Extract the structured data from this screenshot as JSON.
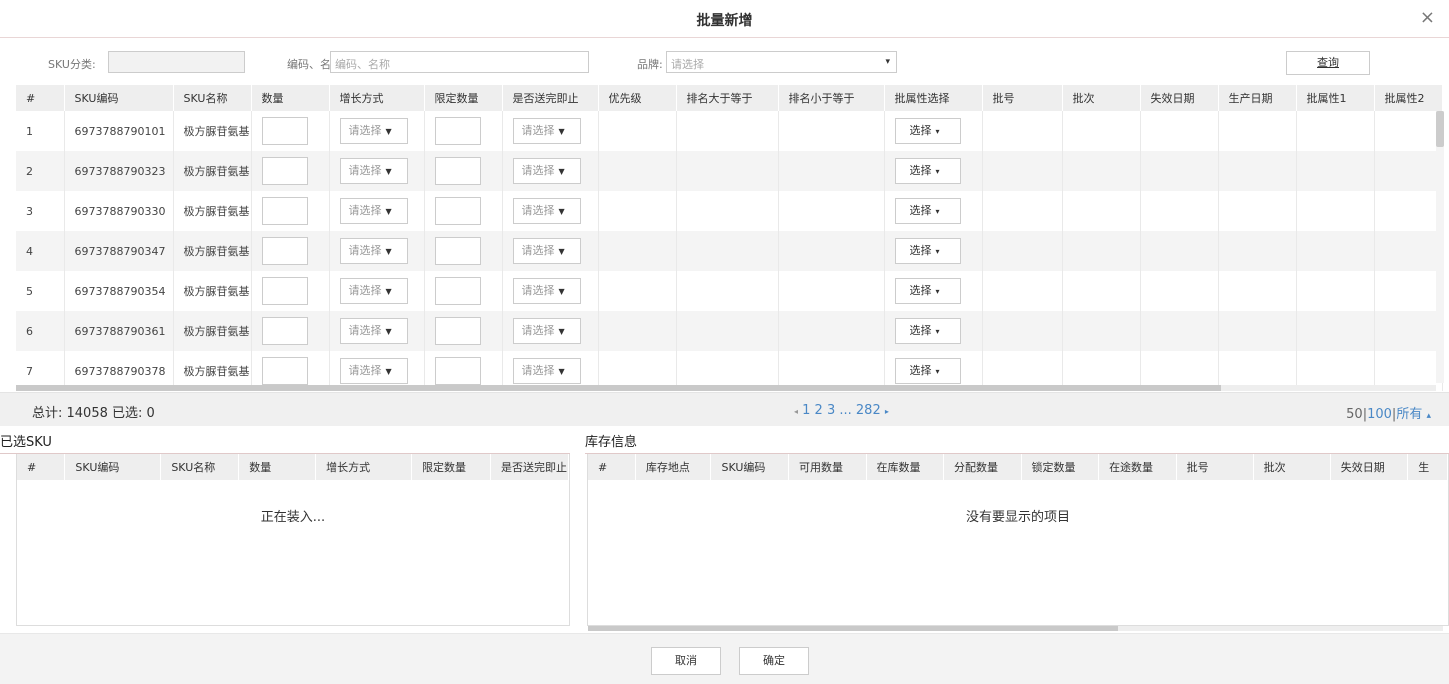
{
  "dialog": {
    "title": "批量新增",
    "close_glyph": "×"
  },
  "filters": {
    "sku_category_label": "SKU分类:",
    "code_name_label": "编码、名称:",
    "code_name_placeholder": "编码、名称",
    "brand_label": "品牌:",
    "brand_placeholder": "请选择",
    "query_label": "查询"
  },
  "main_table": {
    "headers": [
      "#",
      "SKU编码",
      "SKU名称",
      "数量",
      "增长方式",
      "限定数量",
      "是否送完即止",
      "优先级",
      "排名大于等于",
      "排名小于等于",
      "批属性选择",
      "批号",
      "批次",
      "失效日期",
      "生产日期",
      "批属性1",
      "批属性2"
    ],
    "select_placeholder": "请选择",
    "pick_label": "选择",
    "rows": [
      {
        "index": "1",
        "sku_code": "6973788790101",
        "sku_name": "极方脲苷氨基"
      },
      {
        "index": "2",
        "sku_code": "6973788790323",
        "sku_name": "极方脲苷氨基"
      },
      {
        "index": "3",
        "sku_code": "6973788790330",
        "sku_name": "极方脲苷氨基"
      },
      {
        "index": "4",
        "sku_code": "6973788790347",
        "sku_name": "极方脲苷氨基"
      },
      {
        "index": "5",
        "sku_code": "6973788790354",
        "sku_name": "极方脲苷氨基"
      },
      {
        "index": "6",
        "sku_code": "6973788790361",
        "sku_name": "极方脲苷氨基"
      },
      {
        "index": "7",
        "sku_code": "6973788790378",
        "sku_name": "极方脲苷氨基"
      }
    ]
  },
  "summary": {
    "total_text": "总计: 14058 已选: 0",
    "pages": "1 2 3 ... 282",
    "prev_glyph": "◂",
    "next_glyph": "▸",
    "per_page_50": "50",
    "per_page_100": "100",
    "per_page_all": "所有",
    "sep": "|",
    "up_glyph": "▴"
  },
  "selected_sku": {
    "title": "已选SKU",
    "headers": [
      "#",
      "SKU编码",
      "SKU名称",
      "数量",
      "增长方式",
      "限定数量",
      "是否送完即止"
    ],
    "message": "正在装入..."
  },
  "inventory": {
    "title": "库存信息",
    "headers": [
      "#",
      "库存地点",
      "SKU编码",
      "可用数量",
      "在库数量",
      "分配数量",
      "锁定数量",
      "在途数量",
      "批号",
      "批次",
      "失效日期",
      "生"
    ],
    "message": "没有要显示的项目"
  },
  "footer": {
    "cancel_label": "取消",
    "confirm_label": "确定"
  }
}
